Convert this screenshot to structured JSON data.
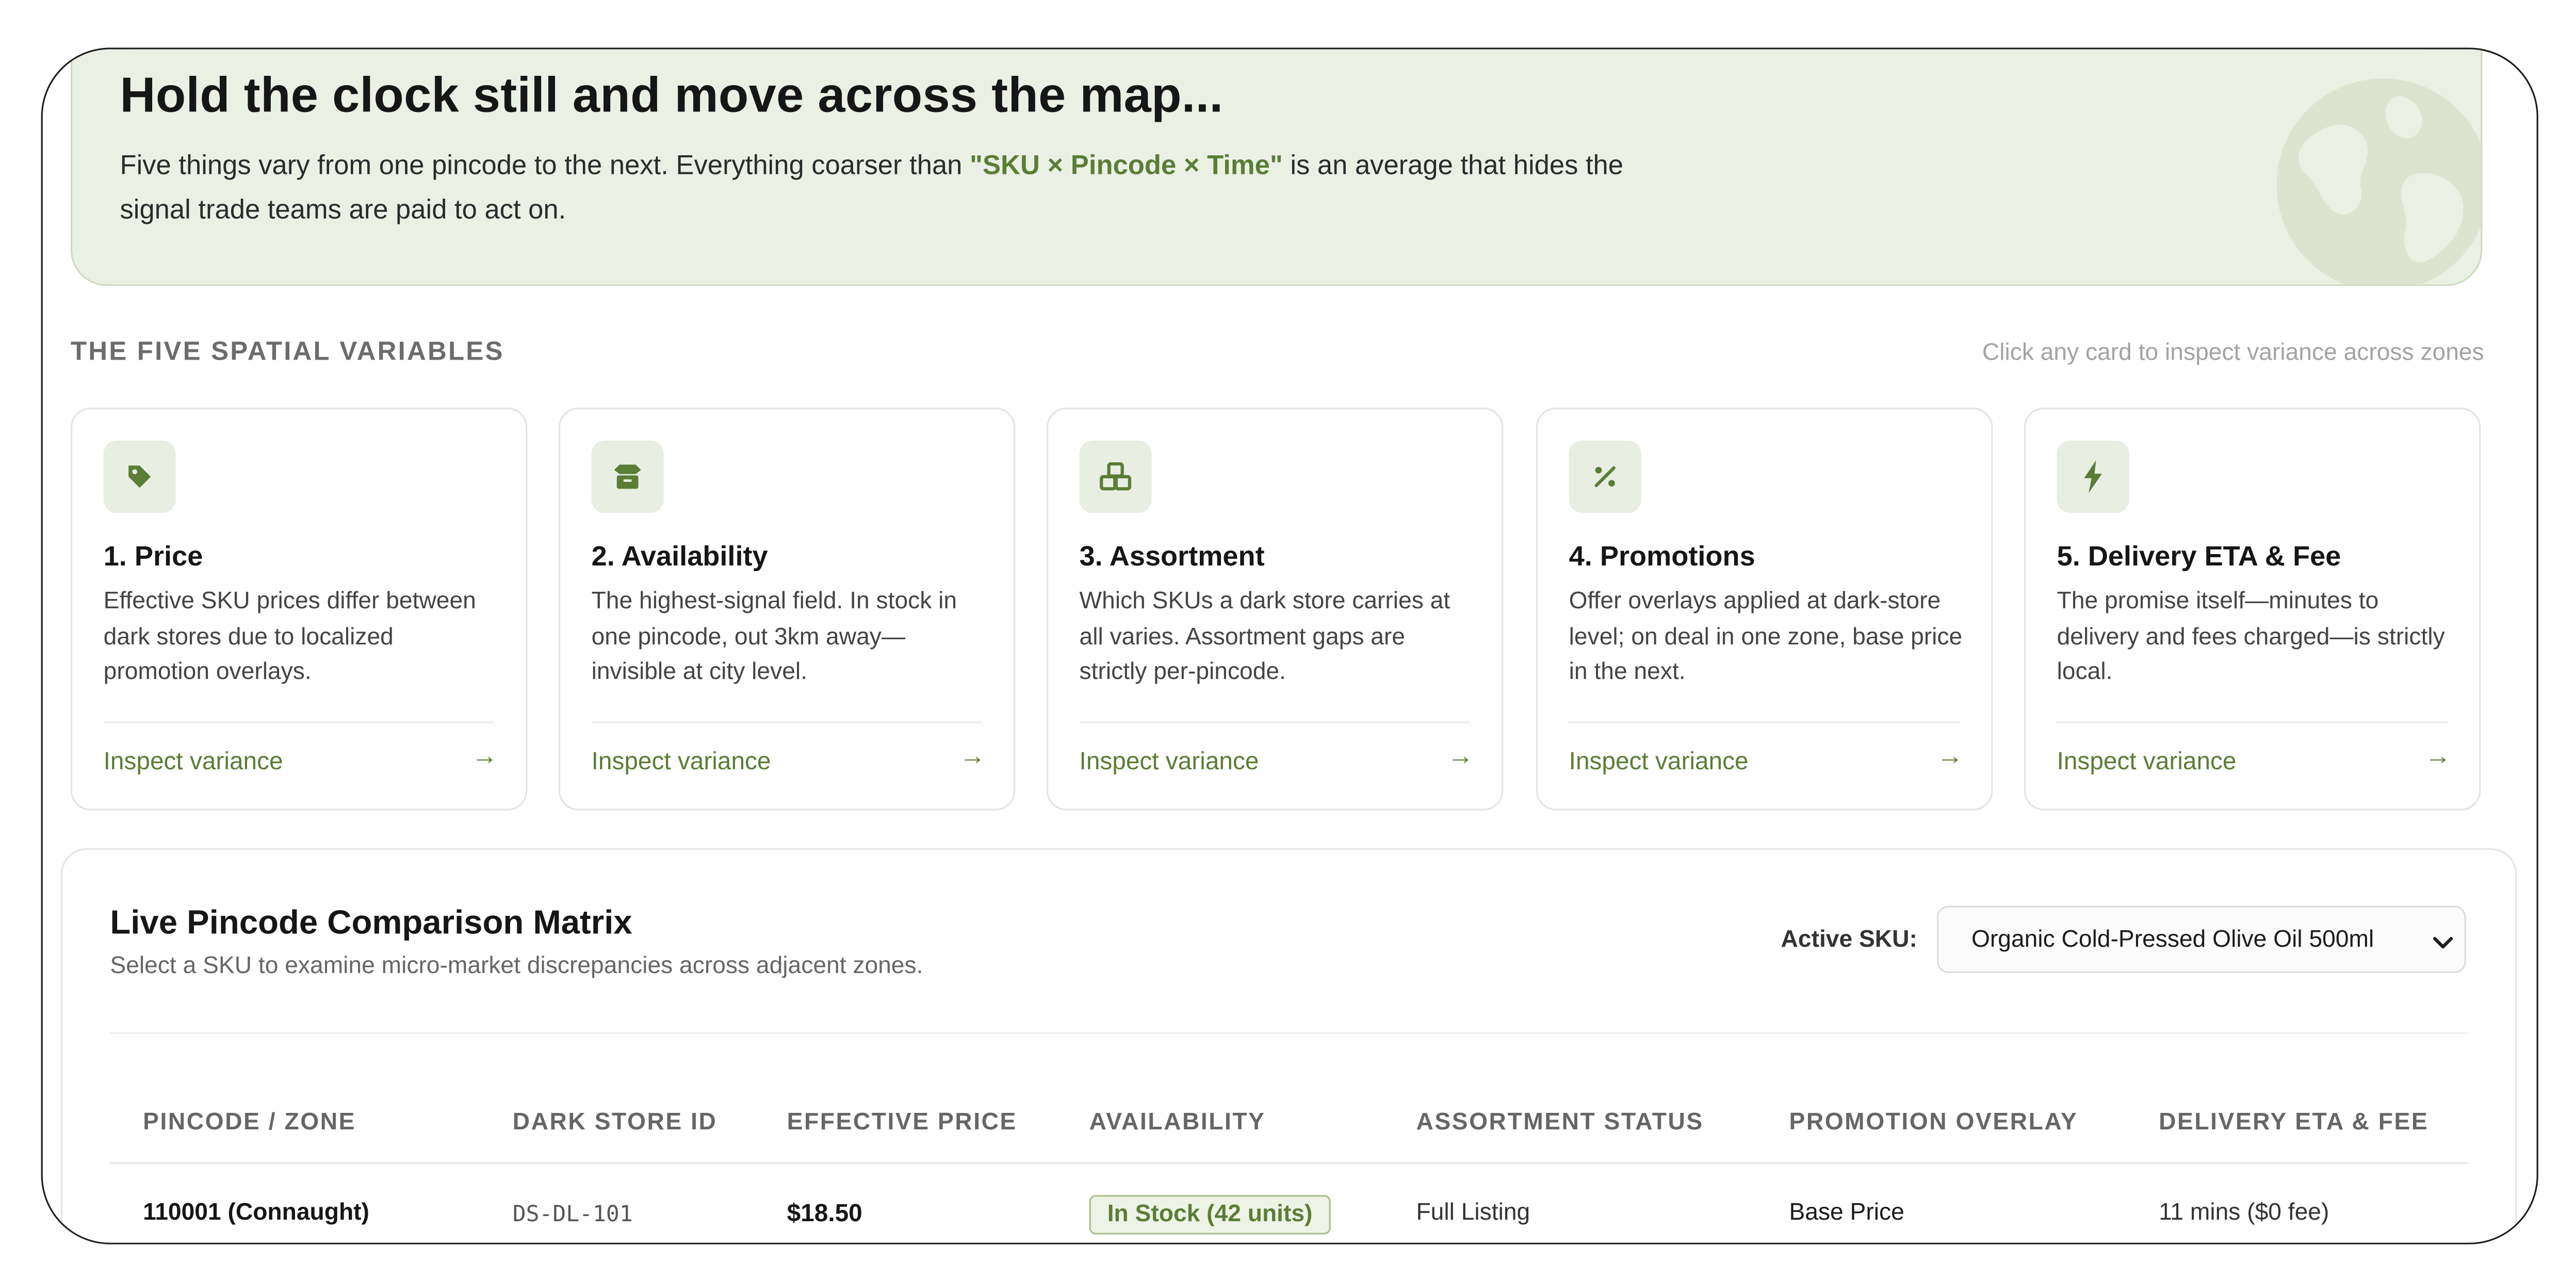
{
  "hero": {
    "title": "Hold the clock still and move across the map...",
    "desc_before": "Five things vary from one pincode to the next. Everything coarser than ",
    "desc_highlight": "\"SKU × Pincode × Time\"",
    "desc_after": " is an average that hides the signal trade teams are paid to act on."
  },
  "section": {
    "title": "THE FIVE SPATIAL VARIABLES",
    "hint": "Click any card to inspect variance across zones"
  },
  "cards": [
    {
      "icon": "tag-icon",
      "title": "1. Price",
      "desc": "Effective SKU prices differ between dark stores due to localized promotion overlays.",
      "link": "Inspect variance"
    },
    {
      "icon": "box-open-icon",
      "title": "2. Availability",
      "desc": "The highest-signal field. In stock in one pincode, out 3km away—invisible at city level.",
      "link": "Inspect variance"
    },
    {
      "icon": "cubes-icon",
      "title": "3. Assortment",
      "desc": "Which SKUs a dark store carries at all varies. Assortment gaps are strictly per-pincode.",
      "link": "Inspect variance"
    },
    {
      "icon": "percent-icon",
      "title": "4. Promotions",
      "desc": "Offer overlays applied at dark-store level; on deal in one zone, base price in the next.",
      "link": "Inspect variance"
    },
    {
      "icon": "bolt-icon",
      "title": "5. Delivery ETA & Fee",
      "desc": "The promise itself—minutes to delivery and fees charged—is strictly local.",
      "link": "Inspect variance"
    }
  ],
  "matrix": {
    "title": "Live Pincode Comparison Matrix",
    "subtitle": "Select a SKU to examine micro-market discrepancies across adjacent zones.",
    "sku_label": "Active SKU:",
    "sku_selected": "Organic Cold-Pressed Olive Oil 500ml",
    "columns": [
      "PINCODE / ZONE",
      "DARK STORE ID",
      "EFFECTIVE PRICE",
      "AVAILABILITY",
      "ASSORTMENT STATUS",
      "PROMOTION OVERLAY",
      "DELIVERY ETA & FEE"
    ],
    "rows": [
      {
        "pincode": "110001 (Connaught)",
        "store_id": "DS-DL-101",
        "price": "$18.50",
        "availability": "In Stock (42 units)",
        "assortment": "Full Listing",
        "promotion": "Base Price",
        "delivery": "11 mins ($0 fee)"
      }
    ]
  },
  "colors": {
    "accent": "#5b7d35",
    "hero_bg": "#ebf0e5",
    "icon_bg": "#e9eee3"
  }
}
